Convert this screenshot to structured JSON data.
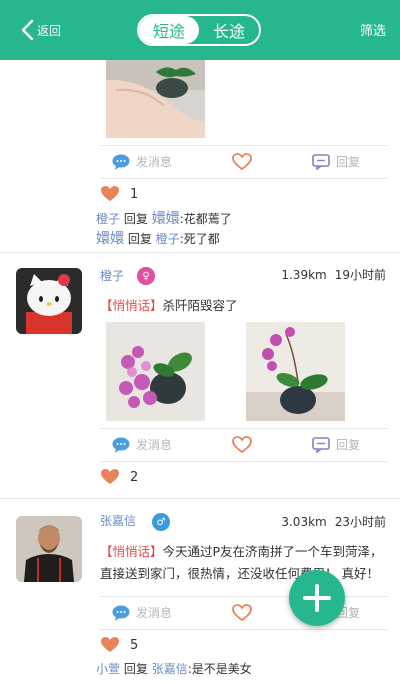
{
  "header": {
    "back_label": "返回",
    "tab_short": "短途",
    "tab_long": "长途",
    "filter_label": "筛选"
  },
  "actions": {
    "message_label": "发消息",
    "reply_label": "回复"
  },
  "post_top": {
    "like_count": "1",
    "comments": [
      {
        "from": "橙子",
        "verb": "回复",
        "to": "嬛嬛",
        "text": ":花都蔫了"
      },
      {
        "from": "嬛嬛",
        "verb": "回复",
        "to": "橙子",
        "text": ":死了都"
      }
    ]
  },
  "post_2": {
    "username": "橙子",
    "badge": "♀",
    "distance": "1.39km",
    "time": "19小时前",
    "tag": "【悄悄话】",
    "text": "杀阡陌毁容了",
    "like_count": "2"
  },
  "post_3": {
    "username": "张嘉信",
    "badge": "♂",
    "distance": "3.03km",
    "time": "23小时前",
    "tag": "【悄悄话】",
    "text": "今天通过P友在济南拼了一个车到菏泽，直接送到家门，很热情，还没收任何费用！ 真好！",
    "like_count": "5",
    "comments": [
      {
        "from": "小萱",
        "verb": "回复",
        "to": "张嘉信",
        "text": ":是不是美女"
      }
    ]
  },
  "colors": {
    "brand": "#26b78f",
    "name_blue": "#6a8ac9",
    "tag_red": "#e24a4a",
    "heart": "#e8845a"
  }
}
